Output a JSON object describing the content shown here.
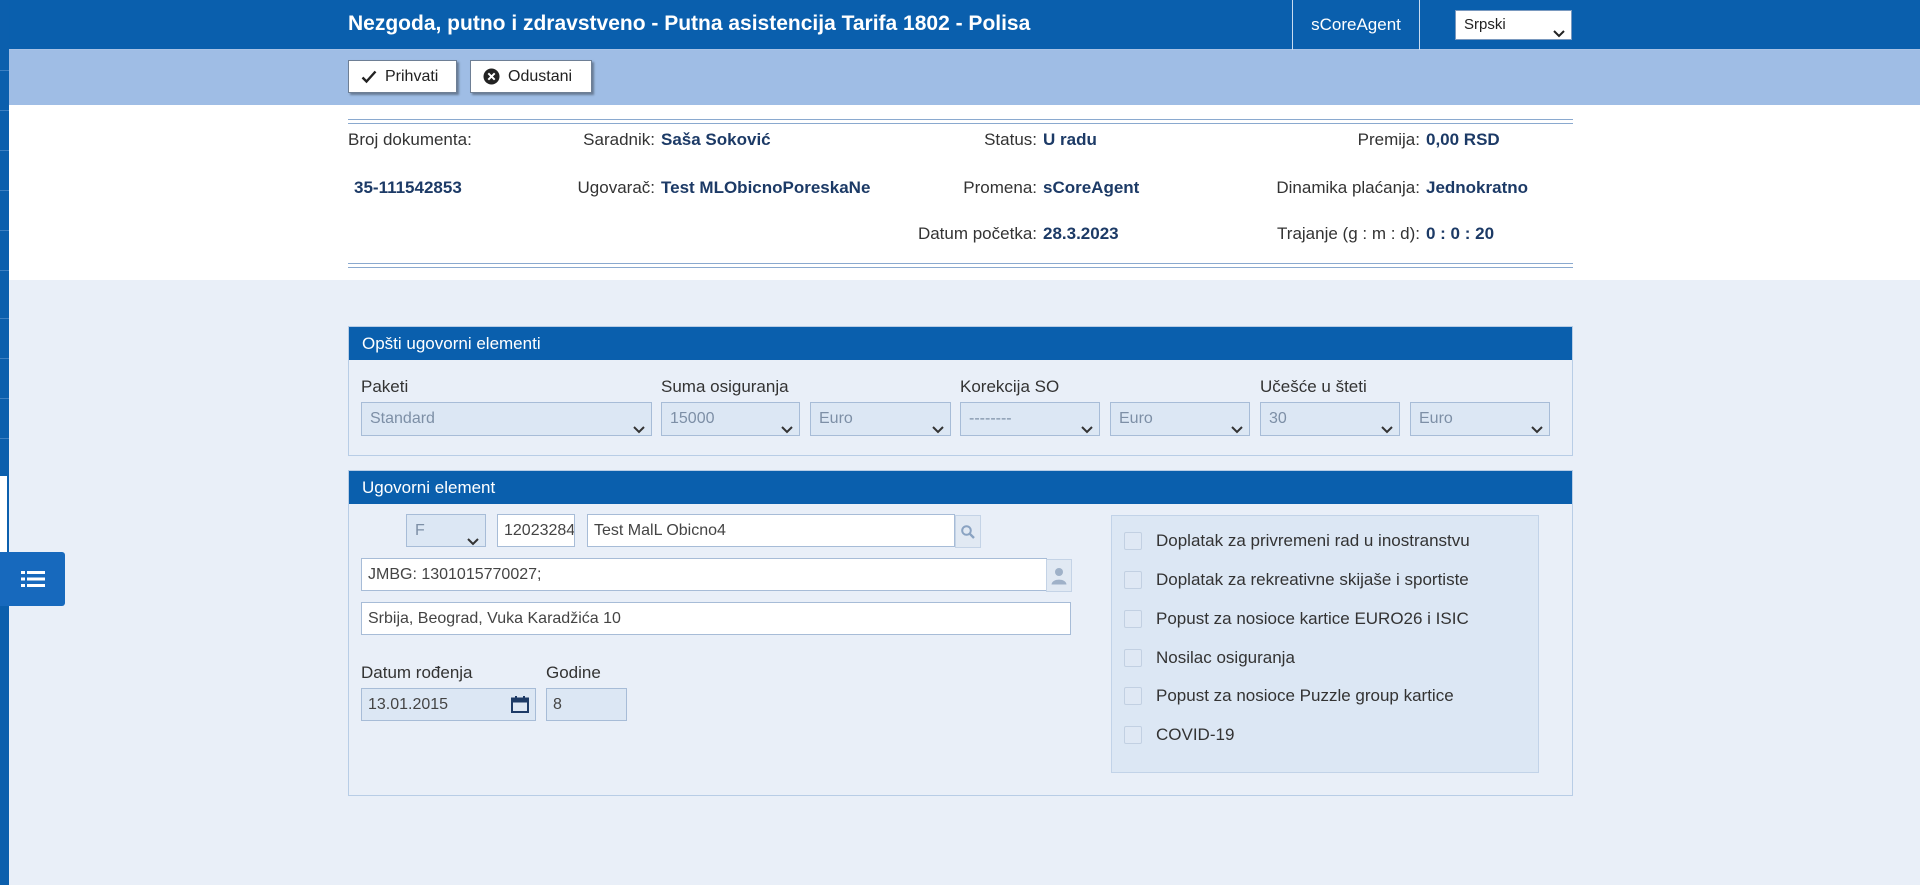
{
  "header": {
    "title": "Nezgoda, putno i zdravstveno - Putna asistencija Tarifa 1802 - Polisa",
    "user": "sCoreAgent",
    "language": "Srpski"
  },
  "toolbar": {
    "accept_label": "Prihvati",
    "cancel_label": "Odustani"
  },
  "document": {
    "doc_number_label": "Broj dokumenta:",
    "doc_number": "35-111542853",
    "associate_label": "Saradnik:",
    "associate": "Saša Soković",
    "contractor_label": "Ugovarač:",
    "contractor": "Test MLObicnoPoreskaNe",
    "status_label": "Status:",
    "status": "U radu",
    "change_label": "Promena:",
    "change": "sCoreAgent",
    "start_date_label": "Datum početka:",
    "start_date": "28.3.2023",
    "premium_label": "Premija:",
    "premium": "0,00 RSD",
    "payment_label": "Dinamika plaćanja:",
    "payment": "Jednokratno",
    "duration_label": "Trajanje (g : m : d):",
    "duration": "0 : 0 : 20"
  },
  "general": {
    "title": "Opšti ugovorni elementi",
    "packages_label": "Paketi",
    "packages_value": "Standard",
    "sum_label": "Suma osiguranja",
    "sum_value": "15000",
    "sum_currency": "Euro",
    "correction_label": "Korekcija SO",
    "correction_value": "--------",
    "correction_currency": "Euro",
    "participation_label": "Učešće u šteti",
    "participation_value": "30",
    "participation_currency": "Euro"
  },
  "element": {
    "title": "Ugovorni element",
    "person_type": "F",
    "id_code": "12023284",
    "name": "Test MalL Obicno4",
    "jmbg": "JMBG: 1301015770027;",
    "address": "Srbija, Beograd, Vuka Karadžića 10",
    "birth_label": "Datum rođenja",
    "birth_value": "13.01.2015",
    "age_label": "Godine",
    "age_value": "8",
    "options": [
      "Doplatak za privremeni rad u inostranstvu",
      "Doplatak za rekreativne skijaše i sportiste",
      "Popust za nosioce kartice EURO26 i ISIC",
      "Nosilac osiguranja",
      "Popust za nosioce Puzzle group kartice",
      "COVID-19"
    ]
  },
  "colors": {
    "header_blue": "#0a5fad",
    "toolbar_blue": "#9fbde5",
    "background": "#e9eff8"
  }
}
